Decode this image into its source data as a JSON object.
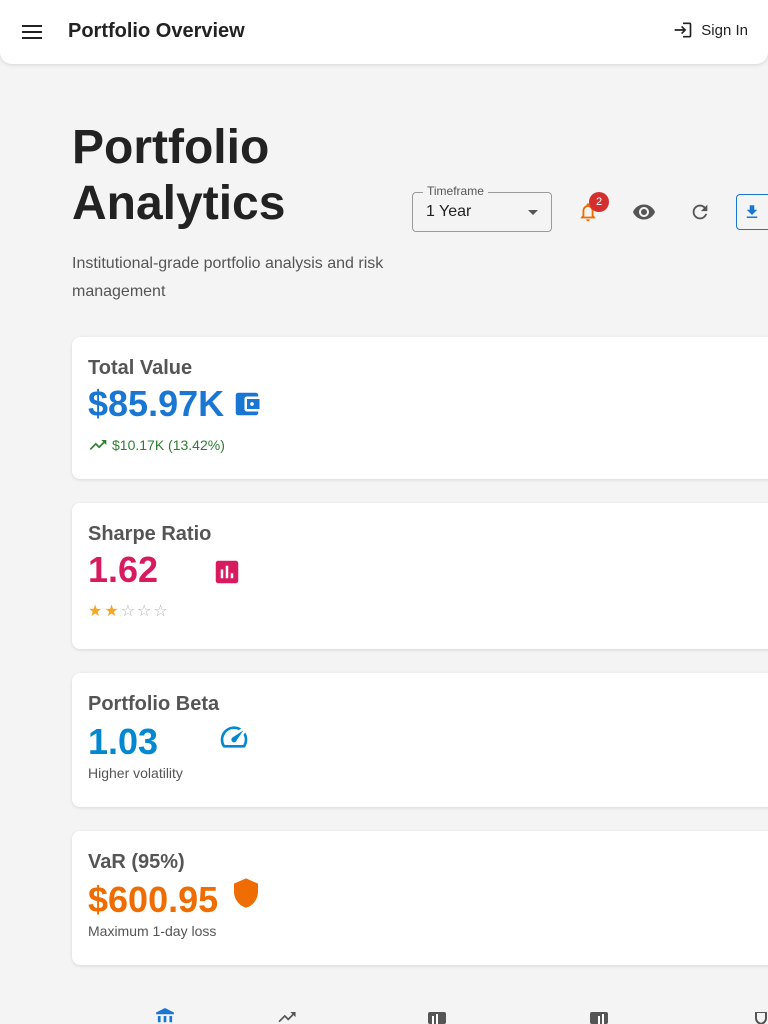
{
  "appbar": {
    "title": "Portfolio Overview",
    "sign_in_label": "Sign In"
  },
  "header": {
    "title": "Portfolio Analytics",
    "subtitle": "Institutional-grade portfolio analysis and risk management"
  },
  "controls": {
    "timeframe_label": "Timeframe",
    "timeframe_value": "1 Year",
    "notification_count": "2"
  },
  "cards": {
    "total_value": {
      "title": "Total Value",
      "value": "$85.97K",
      "change": "$10.17K (13.42%)",
      "color": "#1976d2",
      "change_color": "#2e7d32"
    },
    "sharpe": {
      "title": "Sharpe Ratio",
      "value": "1.62",
      "rating": 2,
      "rating_max": 5,
      "color": "#d81b60"
    },
    "beta": {
      "title": "Portfolio Beta",
      "value": "1.03",
      "note": "Higher volatility",
      "color": "#0288d1"
    },
    "var": {
      "title": "VaR (95%)",
      "value": "$600.95",
      "note": "Maximum 1-day loss",
      "color": "#ef6c00"
    }
  },
  "icons": [
    "menu-icon",
    "login-icon",
    "bell-icon",
    "eye-icon",
    "refresh-icon",
    "download-icon",
    "wallet-icon",
    "bar-chart-icon",
    "speed-icon",
    "shield-icon",
    "bank-icon",
    "trending-icon",
    "chart-icon",
    "analytics-icon",
    "security-icon"
  ]
}
